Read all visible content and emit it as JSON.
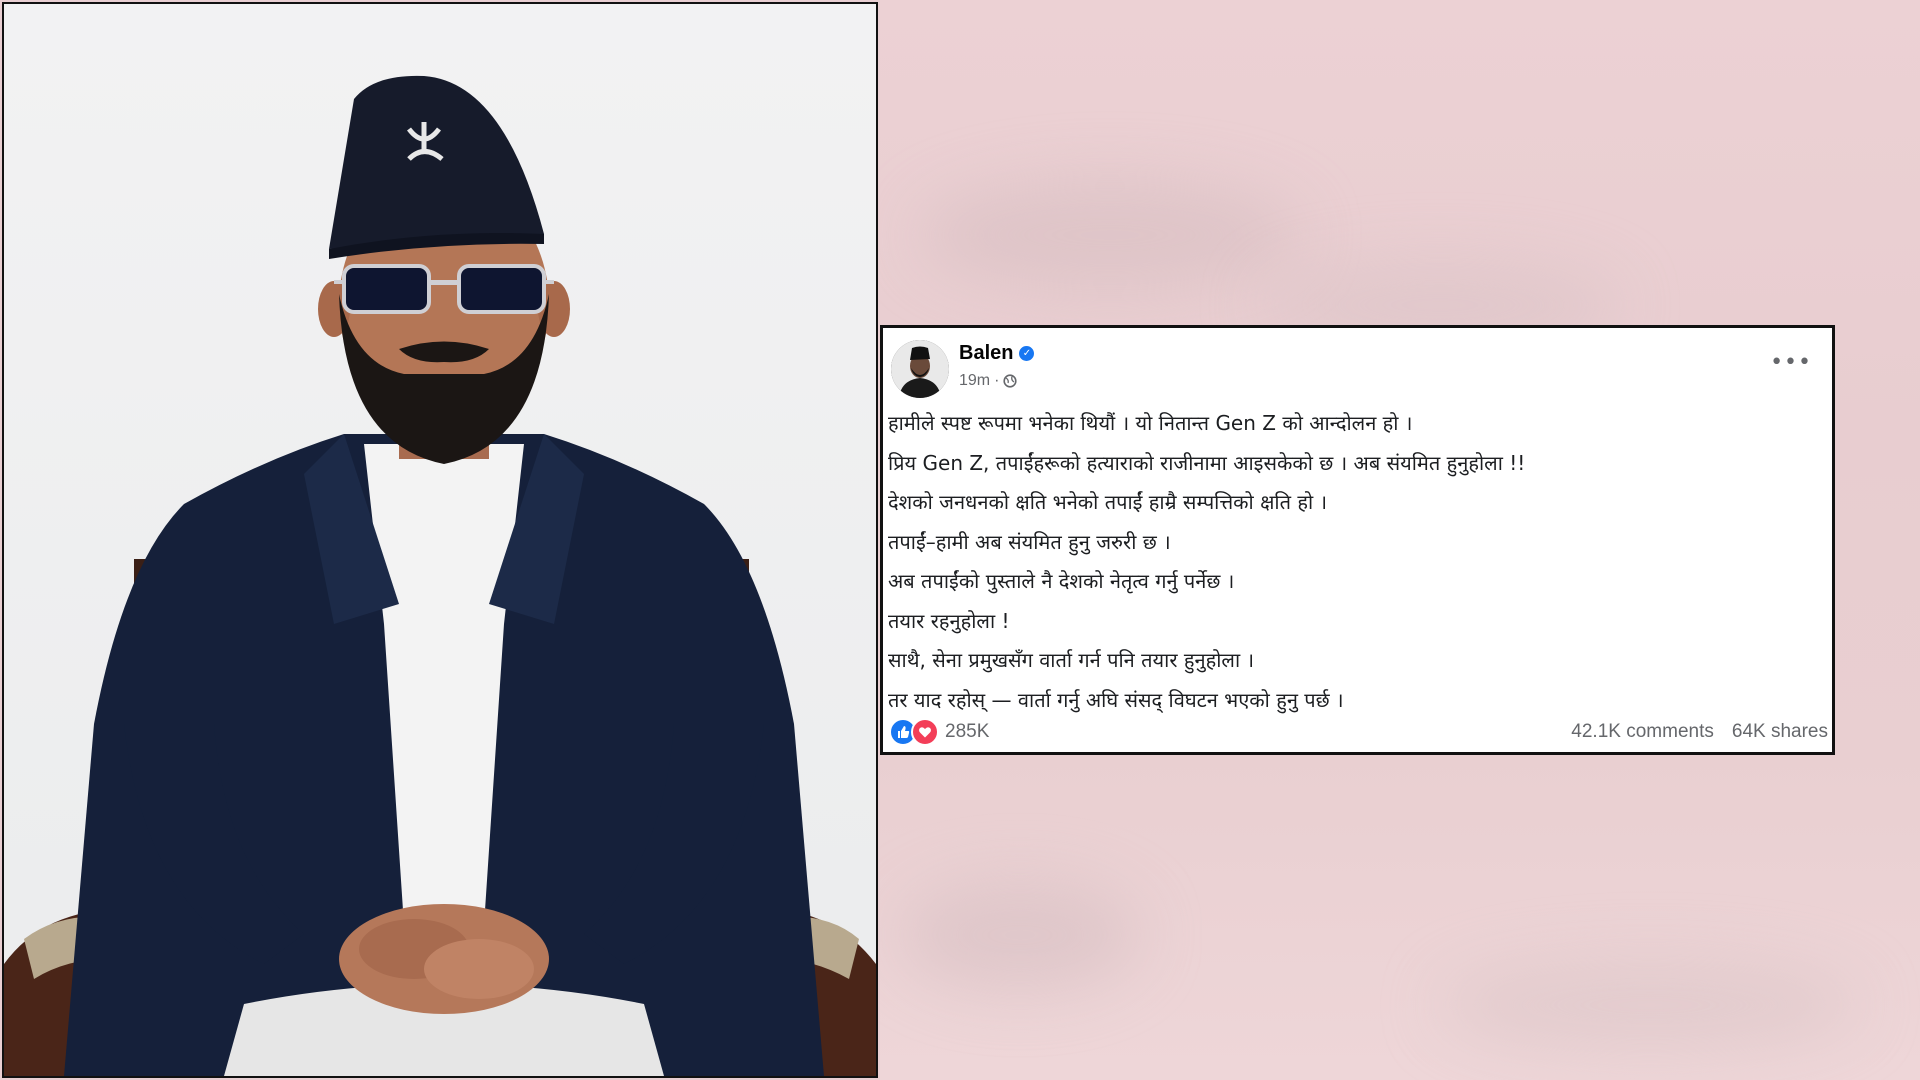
{
  "post": {
    "author": "Balen",
    "time": "19m",
    "separator": "·",
    "more": "•••",
    "lines": [
      "हामीले स्पष्ट रूपमा भनेका थियौं । यो नितान्त Gen Z को आन्दोलन हो ।",
      "प्रिय Gen Z, तपाईंहरूको हत्याराको राजीनामा आइसकेको छ । अब संयमित हुनुहोला !!",
      "देशको जनधनको क्षति भनेको तपाईं हाम्रै सम्पत्तिको क्षति हो ।",
      "तपाईं–हामी अब संयमित हुनु जरुरी छ ।",
      "अब तपाईंको पुस्ताले नै देशको नेतृत्व गर्नु पर्नेछ ।",
      "तयार रहनुहोला !",
      "साथै, सेना प्रमुखसँग वार्ता गर्न पनि  तयार हुनुहोला ।",
      "तर याद रहोस् — वार्ता गर्नु अघि संसद् विघटन भएको हुनु पर्छ ।"
    ],
    "reactions": "285K",
    "comments": "42.1K comments",
    "shares": "64K shares"
  },
  "icons": {
    "verified": "verified-badge-icon",
    "privacy": "globe-icon",
    "like": "like-icon",
    "love": "love-icon"
  },
  "colors": {
    "brand_blue": "#1877f2",
    "love_red": "#f33e58",
    "background": "#e9cfd2",
    "suit": "#15203a"
  }
}
